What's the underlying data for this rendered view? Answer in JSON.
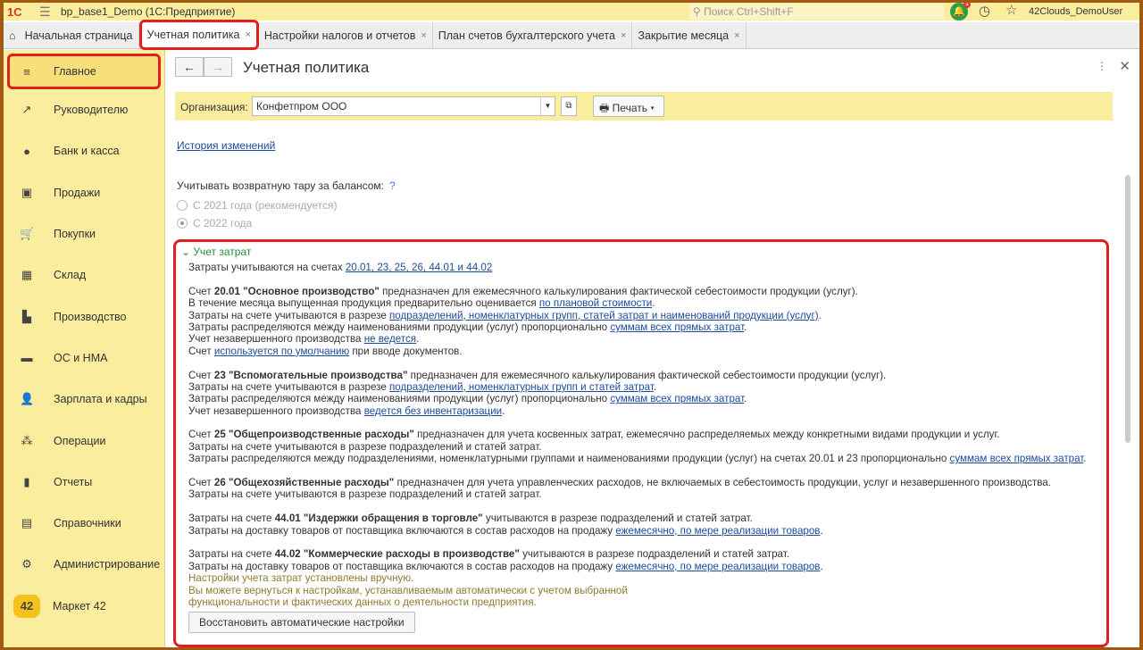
{
  "topbar": {
    "logo": "1С",
    "title": "bp_base1_Demo  (1С:Предприятие)",
    "search_placeholder": "Поиск Ctrl+Shift+F",
    "notif_count": "1",
    "user": "42Clouds_DemoUser"
  },
  "tabs": [
    {
      "label": "Начальная страница"
    },
    {
      "label": "Учетная политика"
    },
    {
      "label": "Настройки налогов и отчетов"
    },
    {
      "label": "План счетов бухгалтерского учета"
    },
    {
      "label": "Закрытие месяца"
    }
  ],
  "sidebar": [
    {
      "label": "Главное",
      "icon": "≡"
    },
    {
      "label": "Руководителю",
      "icon": "↗"
    },
    {
      "label": "Банк и касса",
      "icon": "●"
    },
    {
      "label": "Продажи",
      "icon": "▣"
    },
    {
      "label": "Покупки",
      "icon": "🛒"
    },
    {
      "label": "Склад",
      "icon": "▦"
    },
    {
      "label": "Производство",
      "icon": "▙"
    },
    {
      "label": "ОС и НМА",
      "icon": "▬"
    },
    {
      "label": "Зарплата и кадры",
      "icon": "👤"
    },
    {
      "label": "Операции",
      "icon": "⁂"
    },
    {
      "label": "Отчеты",
      "icon": "▮"
    },
    {
      "label": "Справочники",
      "icon": "▤"
    },
    {
      "label": "Администрирование",
      "icon": "⚙"
    },
    {
      "label": "Маркет 42",
      "icon": "42"
    }
  ],
  "page": {
    "title": "Учетная политика",
    "org_label": "Организация:",
    "org_value": "Конфетпром ООО",
    "print_label": "Печать",
    "history_link": "История изменений",
    "return_label": "Учитывать возвратную тару за балансом:",
    "help": "?",
    "radio1": "С 2021 года (рекомендуется)",
    "radio2": "С 2022 года",
    "group_title": "Учет затрат",
    "restore_button": "Восстановить автоматические настройки"
  },
  "lines": [
    [
      {
        "t": "Затраты учитываются на счетах "
      },
      {
        "t": "20.01, 23, 25, 26, 44.01 и 44.02",
        "l": 1
      }
    ],
    [],
    [
      {
        "t": "Счет "
      },
      {
        "t": "20.01 \"Основное производство\"",
        "b": 1
      },
      {
        "t": " предназначен для ежемесячного калькулирования фактической себестоимости продукции (услуг)."
      }
    ],
    [
      {
        "t": "В течение месяца выпущенная продукция предварительно оценивается "
      },
      {
        "t": "по плановой стоимости",
        "l": 1
      },
      {
        "t": "."
      }
    ],
    [
      {
        "t": "Затраты на счете учитываются в разрезе "
      },
      {
        "t": "подразделений, номенклатурных групп, статей затрат и наименований продукции (услуг)",
        "l": 1
      },
      {
        "t": "."
      }
    ],
    [
      {
        "t": "Затраты распределяются между наименованиями продукции (услуг) пропорционально "
      },
      {
        "t": "суммам всех прямых затрат",
        "l": 1
      },
      {
        "t": "."
      }
    ],
    [
      {
        "t": "Учет незавершенного производства "
      },
      {
        "t": "не ведется",
        "l": 1
      },
      {
        "t": "."
      }
    ],
    [
      {
        "t": "Счет "
      },
      {
        "t": "используется по умолчанию",
        "l": 1
      },
      {
        "t": " при вводе документов."
      }
    ],
    [],
    [
      {
        "t": "Счет "
      },
      {
        "t": "23 \"Вспомогательные производства\"",
        "b": 1
      },
      {
        "t": " предназначен для ежемесячного калькулирования фактической себестоимости продукции (услуг)."
      }
    ],
    [
      {
        "t": "Затраты на счете учитываются в разрезе "
      },
      {
        "t": "подразделений, номенклатурных групп и статей затрат",
        "l": 1
      },
      {
        "t": "."
      }
    ],
    [
      {
        "t": "Затраты распределяются между наименованиями продукции (услуг) пропорционально "
      },
      {
        "t": "суммам всех прямых затрат",
        "l": 1
      },
      {
        "t": "."
      }
    ],
    [
      {
        "t": "Учет незавершенного производства "
      },
      {
        "t": "ведется без инвентаризации",
        "l": 1
      },
      {
        "t": "."
      }
    ],
    [],
    [
      {
        "t": "Счет "
      },
      {
        "t": "25 \"Общепроизводственные расходы\"",
        "b": 1
      },
      {
        "t": " предназначен для учета косвенных затрат, ежемесячно распределяемых между конкретными видами продукции и услуг."
      }
    ],
    [
      {
        "t": "Затраты на счете учитываются в разрезе подразделений и статей затрат."
      }
    ],
    [
      {
        "t": "Затраты распределяются между подразделениями, номенклатурными группами и наименованиями продукции (услуг) на счетах 20.01 и 23 пропорционально "
      },
      {
        "t": "суммам всех прямых затрат",
        "l": 1
      },
      {
        "t": "."
      }
    ],
    [],
    [
      {
        "t": "Счет "
      },
      {
        "t": "26 \"Общехозяйственные расходы\"",
        "b": 1
      },
      {
        "t": " предназначен для учета управленческих расходов, не включаемых в себестоимость продукции, услуг и незавершенного производства."
      }
    ],
    [
      {
        "t": "Затраты на счете учитываются в разрезе подразделений и статей затрат."
      }
    ],
    [],
    [
      {
        "t": "Затраты на счете "
      },
      {
        "t": "44.01 \"Издержки обращения в торговле\"",
        "b": 1
      },
      {
        "t": " учитываются в разрезе подразделений и статей затрат."
      }
    ],
    [
      {
        "t": "Затраты на доставку товаров от поставщика включаются в состав расходов на продажу "
      },
      {
        "t": "ежемесячно, по мере реализации товаров",
        "l": 1
      },
      {
        "t": "."
      }
    ],
    [],
    [
      {
        "t": "Затраты на счете "
      },
      {
        "t": "44.02 \"Коммерческие расходы в производстве\"",
        "b": 1
      },
      {
        "t": " учитываются в разрезе подразделений и статей затрат."
      }
    ],
    [
      {
        "t": "Затраты на доставку товаров от поставщика включаются в состав расходов на продажу "
      },
      {
        "t": "ежемесячно, по мере реализации товаров",
        "l": 1
      },
      {
        "t": "."
      }
    ]
  ],
  "notes": [
    "Настройки учета затрат установлены вручную.",
    "Вы можете вернуться к настройкам, устанавливаемым автоматически с учетом выбранной",
    "функциональности и фактических данных о деятельности предприятия."
  ]
}
